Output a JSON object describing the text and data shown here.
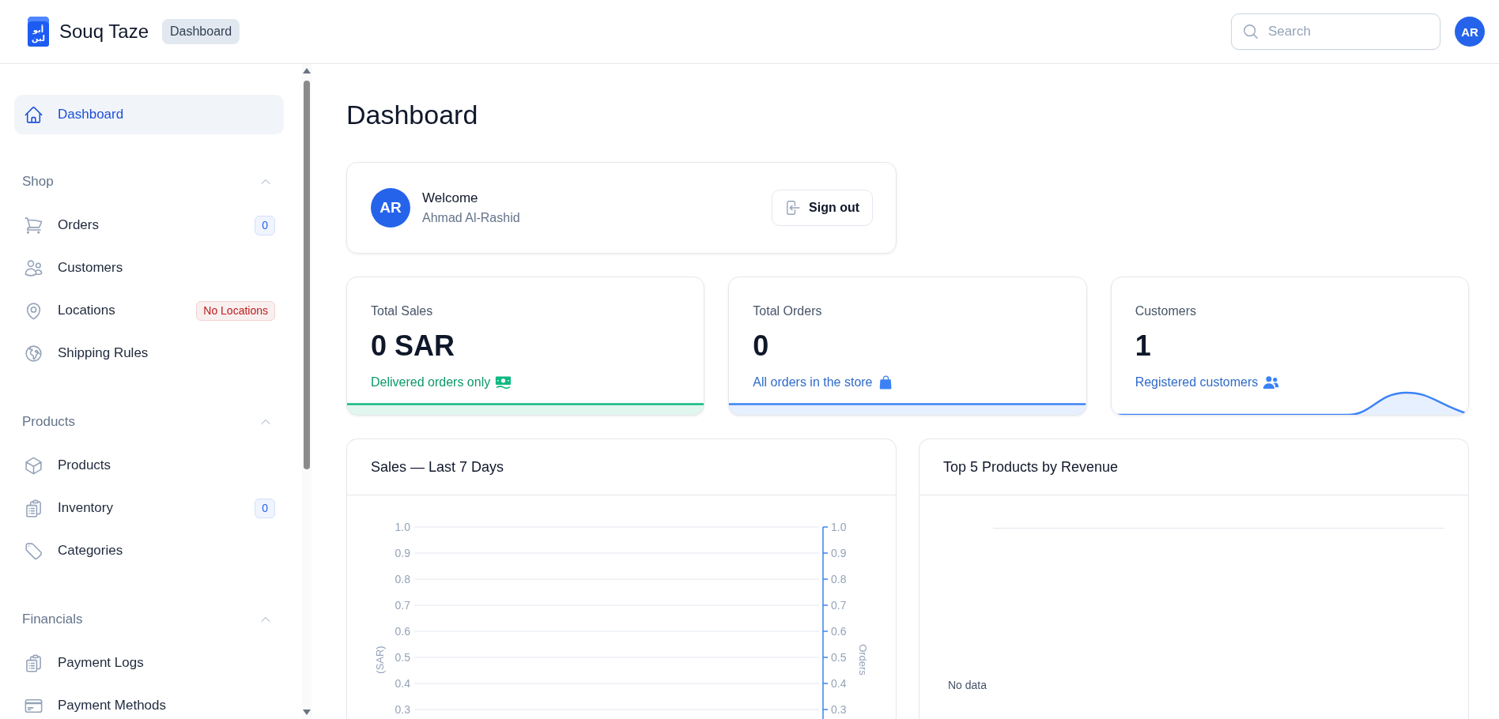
{
  "topbar": {
    "logo_text": [
      "أبو",
      "لبن"
    ],
    "brand": "Souq Taze",
    "breadcrumb": "Dashboard",
    "search": {
      "placeholder": "Search"
    },
    "avatar": "AR"
  },
  "sidebar": {
    "items": [
      {
        "label": "Dashboard",
        "selected": true
      }
    ],
    "sections": [
      {
        "title": "Shop",
        "expanded": true,
        "items": [
          {
            "label": "Orders",
            "selected": false,
            "badge": {
              "text": "0",
              "color": "#2563eb"
            }
          },
          {
            "label": "Customers",
            "selected": false
          },
          {
            "label": "Locations",
            "selected": false,
            "badge": {
              "text": "No Locations",
              "color": "#b91c1c"
            }
          },
          {
            "label": "Shipping Rules",
            "selected": false
          }
        ]
      },
      {
        "title": "Products",
        "expanded": true,
        "items": [
          {
            "label": "Products",
            "selected": false
          },
          {
            "label": "Inventory",
            "selected": false,
            "badge": {
              "text": "0",
              "color": "#2563eb"
            }
          },
          {
            "label": "Categories",
            "selected": false
          }
        ]
      },
      {
        "title": "Financials",
        "expanded": true,
        "items": [
          {
            "label": "Payment Logs",
            "selected": false
          },
          {
            "label": "Payment Methods",
            "selected": false
          }
        ]
      }
    ]
  },
  "page": {
    "title": "Dashboard"
  },
  "welcome": {
    "avatar": "AR",
    "greeting": "Welcome",
    "name": "Ahmad Al-Rashid",
    "button": "Sign out"
  },
  "stats": [
    {
      "kind": "flat",
      "label": "Total Sales",
      "value": "0 SAR",
      "caption": "Delivered orders only",
      "color": "#10b981"
    },
    {
      "kind": "flat",
      "label": "Total Orders",
      "value": "0",
      "caption": "All orders in the store",
      "color": "#3b82f6"
    },
    {
      "kind": "peak",
      "label": "Customers",
      "value": "1",
      "caption": "Registered customers",
      "color": "#3b82f6"
    }
  ],
  "charts": [
    {
      "title": "Sales — Last 7 Days",
      "left_axis": {
        "label": "(SAR)",
        "ticks": [
          "1.0",
          "0.9",
          "0.8",
          "0.7",
          "0.6",
          "0.5",
          "0.4",
          "0.3"
        ]
      },
      "right_axis": {
        "label": "Orders",
        "ticks": [
          "1.0",
          "0.9",
          "0.8",
          "0.7",
          "0.6",
          "0.5",
          "0.4",
          "0.3"
        ]
      }
    },
    {
      "title": "Top 5 Products by Revenue",
      "empty_text": "No data"
    }
  ]
}
